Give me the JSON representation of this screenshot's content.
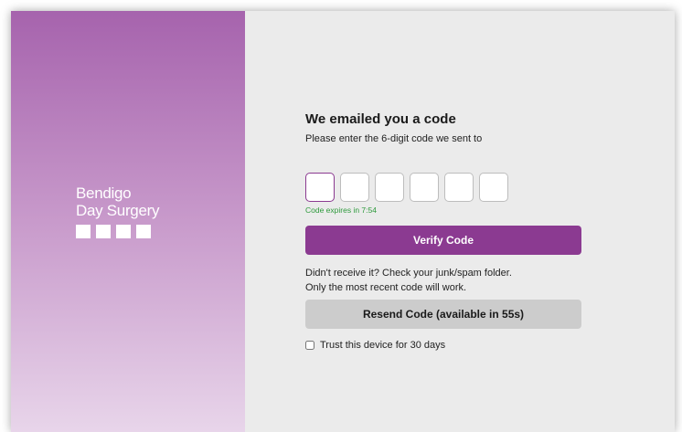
{
  "brand": {
    "name_line1": "Bendigo",
    "name_line2": "Day Surgery",
    "square_count": 4
  },
  "form": {
    "title": "We emailed you a code",
    "subtitle": "Please enter the 6-digit code we sent to",
    "code_digits": [
      "",
      "",
      "",
      "",
      "",
      ""
    ],
    "expiry_text": "Code expires in 7:54",
    "verify_label": "Verify Code",
    "help_line1": "Didn't receive it? Check your junk/spam folder.",
    "help_line2": "Only the most recent code will work.",
    "resend_label": "Resend Code (available in 55s)",
    "trust_label": "Trust this device for 30 days",
    "trust_checked": false
  },
  "colors": {
    "accent": "#8b3a91",
    "expiry": "#2e9a3c",
    "resend_bg": "#cccccc",
    "panel_bg": "#ebebeb"
  }
}
